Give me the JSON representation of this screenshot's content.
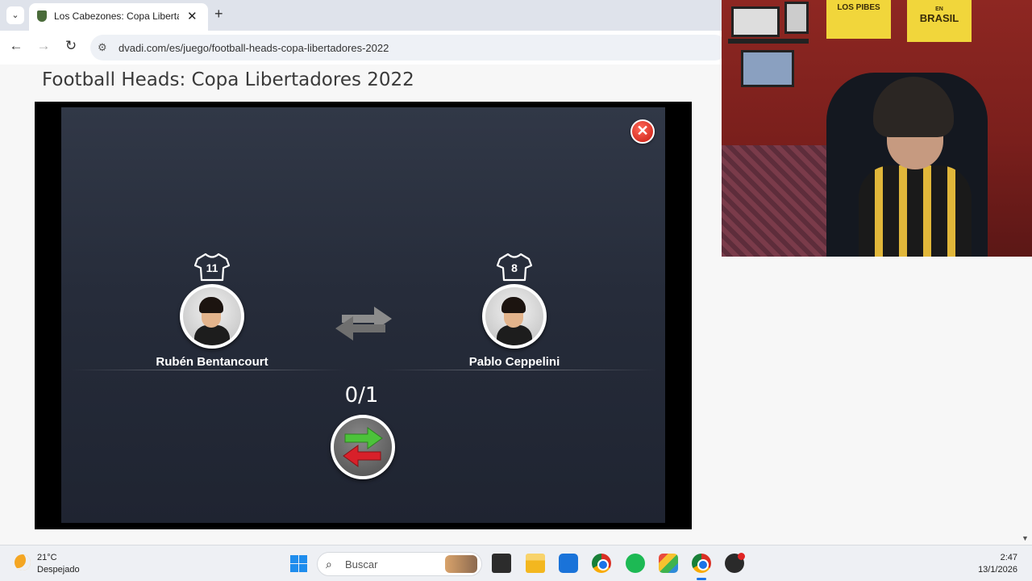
{
  "browser": {
    "tab_title": "Los Cabezones: Copa Libertadores 2022",
    "tab_close": "✕",
    "new_tab": "+",
    "tab_menu": "⌄",
    "back": "←",
    "forward": "→",
    "reload": "↻",
    "url": "dvadi.com/es/juego/football-heads-copa-libertadores-2022"
  },
  "page": {
    "title": "Football Heads: Copa Libertadores 2022"
  },
  "game": {
    "close_label": "✕",
    "player_out": {
      "name": "Rubén Bentancourt",
      "number": "11"
    },
    "player_in": {
      "name": "Pablo Ceppelini",
      "number": "8"
    },
    "substitutions": "0/1"
  },
  "webcam": {
    "poster1": "LOS PIBES",
    "poster2_small": "EN",
    "poster2_big": "BRASIL"
  },
  "taskbar": {
    "weather_temp": "21°C",
    "weather_cond": "Despejado",
    "search_placeholder": "Buscar",
    "search_icon": "⌕",
    "time": "2:47",
    "date": "13/1/2026"
  },
  "colors": {
    "game_bg": "#262c3a",
    "close_red": "#c8190f",
    "swap_green": "#4cc23a",
    "swap_red": "#d8202a"
  }
}
